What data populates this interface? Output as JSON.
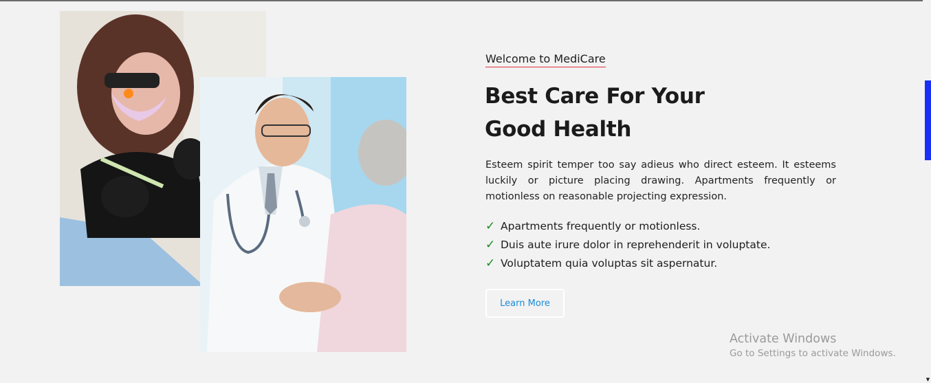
{
  "about": {
    "eyebrow": "Welcome to MediCare",
    "headline_line1": "Best Care For Your",
    "headline_line2": "Good Health",
    "lead": "Esteem spirit temper too say adieus who direct esteem. It esteems luckily or picture placing drawing. Apartments frequently or motionless on reasonable projecting expression.",
    "checklist": [
      "Apartments frequently or motionless.",
      "Duis aute irure dolor in reprehenderit in voluptate.",
      "Voluptatem quia voluptas sit aspernatur."
    ],
    "button_label": "Learn More"
  },
  "watermark": {
    "title": "Activate Windows",
    "subtitle": "Go to Settings to activate Windows."
  },
  "icons": {
    "check": "check-mark-icon"
  },
  "colors": {
    "accent_underline": "#e0303a",
    "check_green": "#1a8a22",
    "button_text": "#1a8bd8",
    "scrollbar": "#1a2ff5"
  }
}
